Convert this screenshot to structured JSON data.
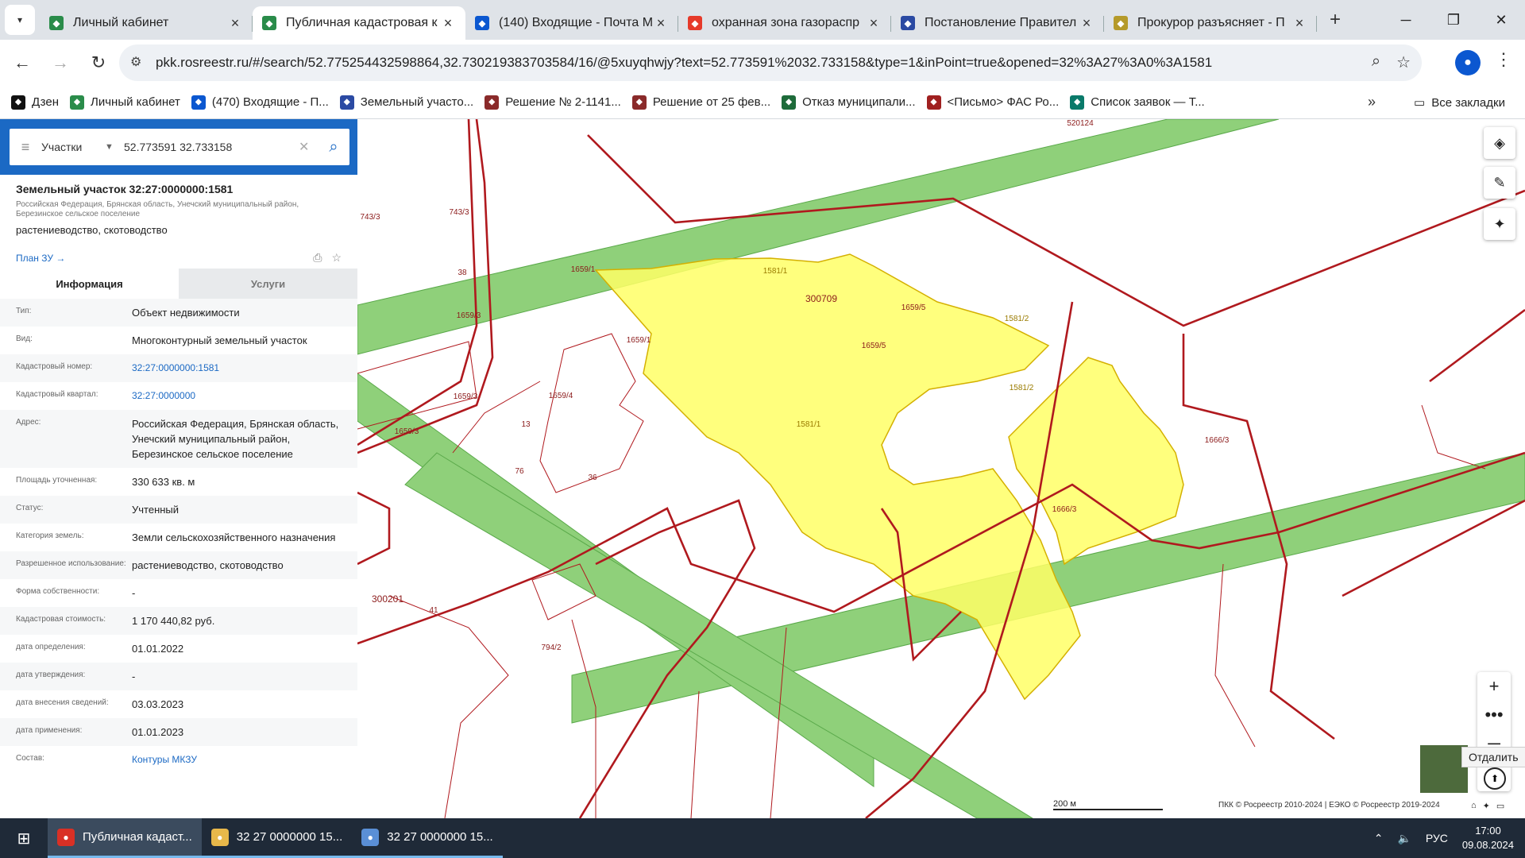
{
  "browser": {
    "tabs": [
      {
        "title": "Личный кабинет",
        "icon": "rosreestr-icon",
        "color": "#2a8c4a",
        "active": false
      },
      {
        "title": "Публичная кадастровая к",
        "icon": "rosreestr-icon",
        "color": "#2a8c4a",
        "active": true
      },
      {
        "title": "(140) Входящие - Почта М",
        "icon": "mail-icon",
        "color": "#0b57d0",
        "active": false
      },
      {
        "title": "охранная зона газораспр",
        "icon": "yandex-icon",
        "color": "#e63a2a",
        "active": false
      },
      {
        "title": "Постановление Правител",
        "icon": "flag-icon",
        "color": "#2b4aa3",
        "active": false
      },
      {
        "title": "Прокурор разъясняет - П",
        "icon": "emblem-icon",
        "color": "#b59a2a",
        "active": false
      }
    ],
    "url": "pkk.rosreestr.ru/#/search/52.775254432598864,32.730219383703584/16/@5xuyqhwjy?text=52.773591%2032.733158&type=1&inPoint=true&opened=32%3A27%3A0%3A1581",
    "bookmarks": [
      {
        "label": "Дзен",
        "color": "#111"
      },
      {
        "label": "Личный кабинет",
        "color": "#2a8c4a"
      },
      {
        "label": "(470) Входящие - П...",
        "color": "#0b57d0"
      },
      {
        "label": "Земельный участо...",
        "color": "#2b4aa3"
      },
      {
        "label": "Решение № 2-1141...",
        "color": "#8a2a2a"
      },
      {
        "label": "Решение от 25 фев...",
        "color": "#8a2a2a"
      },
      {
        "label": "Отказ муниципали...",
        "color": "#1e6b3a"
      },
      {
        "label": "<Письмо> ФАС Ро...",
        "color": "#a02020"
      },
      {
        "label": "Список заявок — Т...",
        "color": "#0a7a6a"
      }
    ],
    "all_bookmarks": "Все закладки",
    "more_bookmarks": "»"
  },
  "search": {
    "category": "Участки",
    "query": "52.773591 32.733158"
  },
  "object": {
    "title": "Земельный участок 32:27:0000000:1581",
    "address_short": "Российская Федерация, Брянская область, Унечский муниципальный район, Березинское сельское поселение",
    "use": "растениеводство, скотоводство",
    "plan_link": "План ЗУ →",
    "tab_info": "Информация",
    "tab_services": "Услуги",
    "rows": [
      {
        "key": "Тип:",
        "value": "Объект недвижимости",
        "link": false
      },
      {
        "key": "Вид:",
        "value": "Многоконтурный земельный участок",
        "link": false
      },
      {
        "key": "Кадастровый номер:",
        "value": "32:27:0000000:1581",
        "link": true
      },
      {
        "key": "Кадастровый квартал:",
        "value": "32:27:0000000",
        "link": true
      },
      {
        "key": "Адрес:",
        "value": "Российская Федерация, Брянская область, Унечский муниципальный район, Березинское сельское поселение",
        "link": false
      },
      {
        "key": "Площадь уточненная:",
        "value": "330 633 кв. м",
        "link": false
      },
      {
        "key": "Статус:",
        "value": "Учтенный",
        "link": false
      },
      {
        "key": "Категория земель:",
        "value": "Земли сельскохозяйственного назначения",
        "link": false
      },
      {
        "key": "Разрешенное использование:",
        "value": "растениеводство, скотоводство",
        "link": false
      },
      {
        "key": "Форма собственности:",
        "value": "-",
        "link": false
      },
      {
        "key": "Кадастровая стоимость:",
        "value": "1 170 440,82 руб.",
        "link": false
      },
      {
        "key": "дата определения:",
        "value": "01.01.2022",
        "link": false
      },
      {
        "key": "дата утверждения:",
        "value": "-",
        "link": false
      },
      {
        "key": "дата внесения сведений:",
        "value": "03.03.2023",
        "link": false
      },
      {
        "key": "дата применения:",
        "value": "01.01.2023",
        "link": false
      },
      {
        "key": "Состав:",
        "value": "Контуры МКЗУ",
        "link": true
      }
    ]
  },
  "map": {
    "labels": [
      {
        "text": "520124",
        "kind": "parcel"
      },
      {
        "text": "743/3",
        "kind": "parcel"
      },
      {
        "text": "743/3",
        "kind": "parcel"
      },
      {
        "text": "38",
        "kind": "parcel"
      },
      {
        "text": "1659/1",
        "kind": "parcel"
      },
      {
        "text": "1581/1",
        "kind": "highlight"
      },
      {
        "text": "300709",
        "kind": "quarter"
      },
      {
        "text": "1659/5",
        "kind": "parcel"
      },
      {
        "text": "1659/3",
        "kind": "parcel"
      },
      {
        "text": "1659/1",
        "kind": "parcel"
      },
      {
        "text": "1659/5",
        "kind": "parcel"
      },
      {
        "text": "1581/2",
        "kind": "highlight"
      },
      {
        "text": "1581/2",
        "kind": "highlight"
      },
      {
        "text": "1659/4",
        "kind": "parcel"
      },
      {
        "text": "1659/3",
        "kind": "parcel"
      },
      {
        "text": "1581/1",
        "kind": "highlight"
      },
      {
        "text": "1659/3",
        "kind": "parcel"
      },
      {
        "text": "13",
        "kind": "parcel"
      },
      {
        "text": "1666/3",
        "kind": "parcel"
      },
      {
        "text": "76",
        "kind": "parcel"
      },
      {
        "text": "36",
        "kind": "parcel"
      },
      {
        "text": "1666/3",
        "kind": "parcel"
      },
      {
        "text": "300201",
        "kind": "quarter"
      },
      {
        "text": "41",
        "kind": "parcel"
      },
      {
        "text": "794/2",
        "kind": "parcel"
      }
    ],
    "zoom_out_tooltip": "Отдалить",
    "scale": "200 м",
    "copyright": "ПКК © Росреестр 2010-2024 | ЕЭКО © Росреестр 2019-2024",
    "colors": {
      "parcel": "#b0191e",
      "zone": "#8fd07a",
      "highlight": "#ffff66"
    }
  },
  "taskbar": {
    "apps": [
      {
        "label": "Публичная кадаст...",
        "icon": "chrome-icon",
        "active": true
      },
      {
        "label": "32  27  0000000  15...",
        "icon": "folder-icon",
        "active": false
      },
      {
        "label": "32  27  0000000  15...",
        "icon": "paint-icon",
        "active": false
      }
    ],
    "lang": "РУС",
    "time": "17:00",
    "date": "09.08.2024"
  }
}
